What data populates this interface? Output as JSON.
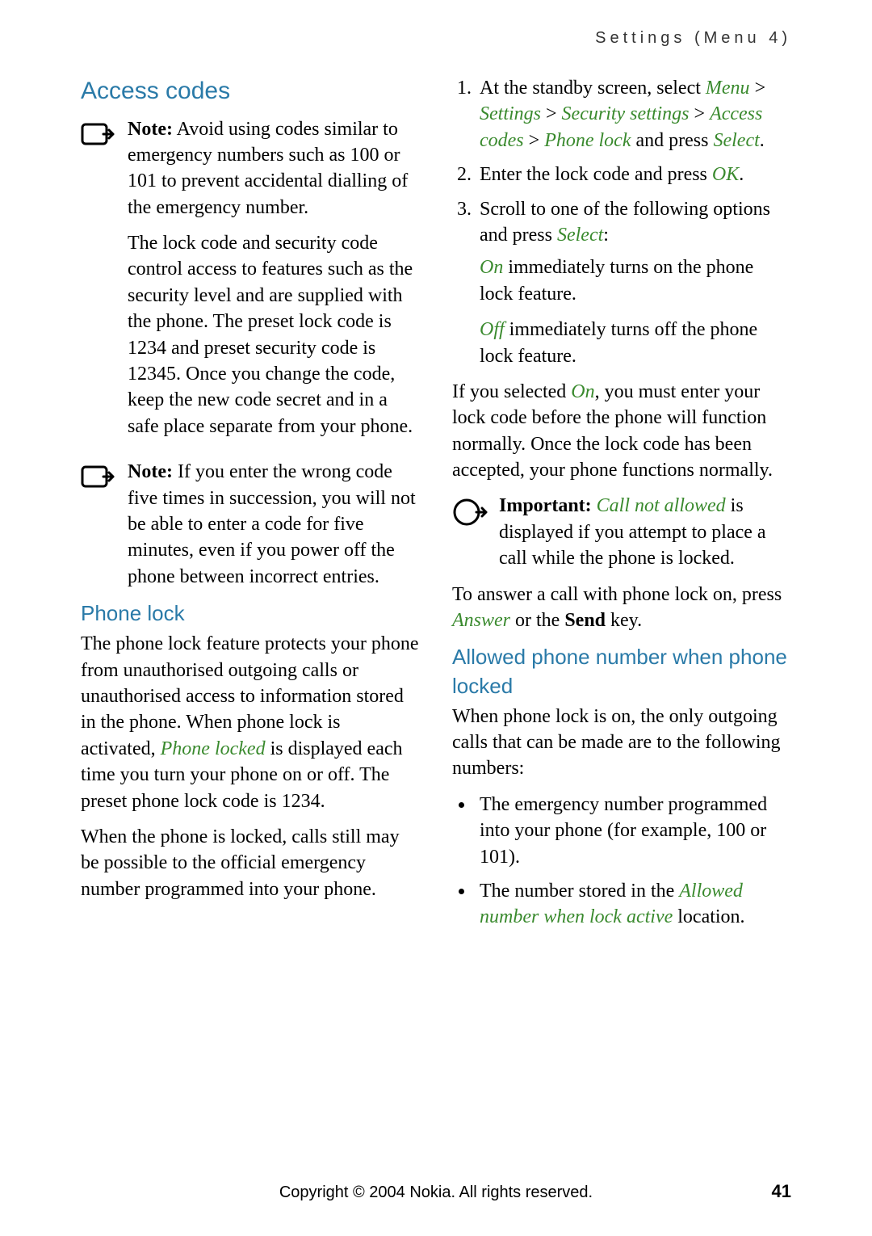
{
  "header": "Settings (Menu 4)",
  "left": {
    "h2": "Access codes",
    "note1_label": "Note:",
    "note1_text": " Avoid using codes similar to emergency numbers such as 100 or 101 to prevent accidental dialling of the emergency number.",
    "para1": "The lock code and security code control access to features such as the security level and are supplied with the phone. The preset lock code is 1234 and preset security code is 12345. Once you change the code, keep the new code secret and in a safe place separate from your phone.",
    "note2_label": "Note:",
    "note2_text": " If you enter the wrong code five times in succession, you will not be able to enter a code for five minutes, even if you power off the phone between incorrect entries.",
    "h3": "Phone lock",
    "pl_a": "The phone lock feature protects your phone from unauthorised outgoing calls or unauthorised access to information stored in the phone. When phone lock is activated, ",
    "pl_b": "Phone locked",
    "pl_c": " is displayed each time you turn your phone on or off. The preset phone lock code is 1234.",
    "pl2": "When the phone is locked, calls still may be possible to the official emergency number programmed into your phone."
  },
  "right": {
    "s1a": "At the standby screen, select ",
    "s1b": "Menu ",
    "gt1": "> ",
    "s1c": "Settings ",
    "gt2": "> ",
    "s1d": "Security settings ",
    "gt3": "> ",
    "s1e": "Access codes ",
    "gt4": "> ",
    "s1f": "Phone lock",
    "s1g": " and press ",
    "s1h": "Select",
    "s1i": ".",
    "s2a": "Enter the lock code and press ",
    "s2b": "OK",
    "s2c": ".",
    "s3a": "Scroll to one of the following options and press ",
    "s3b": "Select",
    "s3c": ":",
    "s3on_a": "On",
    "s3on_b": " immediately turns on the phone lock feature.",
    "s3off_a": "Off",
    "s3off_b": " immediately turns off the phone lock feature.",
    "p_after_a": "If you selected ",
    "p_after_b": "On",
    "p_after_c": ", you must enter your lock code before the phone will function normally. Once the lock code has been accepted, your phone functions normally.",
    "imp_label": "Important:",
    "imp_em": " Call not allowed",
    "imp_rest": " is displayed if you attempt to place a call while the phone is locked.",
    "ans_a": "To answer a call with phone lock on, press ",
    "ans_b": "Answer",
    "ans_c": " or the ",
    "ans_d": "Send",
    "ans_e": " key.",
    "h3": "Allowed phone number when phone locked",
    "allowed_intro": "When phone lock is on, the only outgoing calls that can be made are to the following numbers:",
    "b1": "The emergency number programmed into your phone (for example, 100 or 101).",
    "b2a": "The number stored in the ",
    "b2b": "Allowed number when lock active",
    "b2c": " location."
  },
  "footer": {
    "copy": "Copyright © 2004 Nokia. All rights reserved.",
    "page": "41"
  }
}
